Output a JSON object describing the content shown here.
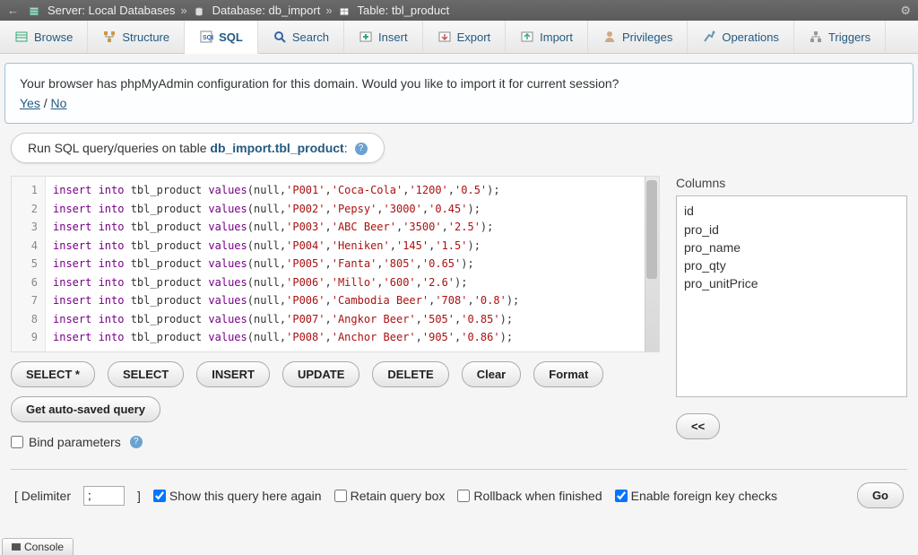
{
  "topbar": {
    "serverPrefix": "Server:",
    "serverName": "Local Databases",
    "dbPrefix": "Database:",
    "dbName": "db_import",
    "tablePrefix": "Table:",
    "tableName": "tbl_product"
  },
  "tabs": [
    {
      "label": "Browse"
    },
    {
      "label": "Structure"
    },
    {
      "label": "SQL"
    },
    {
      "label": "Search"
    },
    {
      "label": "Insert"
    },
    {
      "label": "Export"
    },
    {
      "label": "Import"
    },
    {
      "label": "Privileges"
    },
    {
      "label": "Operations"
    },
    {
      "label": "Triggers"
    }
  ],
  "notice": {
    "text": "Your browser has phpMyAdmin configuration for this domain. Would you like to import it for current session?",
    "yes": "Yes",
    "no": "No"
  },
  "section": {
    "prefix": "Run SQL query/queries on table ",
    "target": "db_import.tbl_product",
    "suffix": ":"
  },
  "editor": {
    "lines": [
      {
        "pre": "insert into",
        "mid": " tbl_product ",
        "kw": "values",
        "args": "(null,'P001','Coca-Cola','1200','0.5');"
      },
      {
        "pre": "insert into",
        "mid": " tbl_product ",
        "kw": "values",
        "args": "(null,'P002','Pepsy','3000','0.45');"
      },
      {
        "pre": "insert into",
        "mid": " tbl_product ",
        "kw": "values",
        "args": "(null,'P003','ABC Beer','3500','2.5');"
      },
      {
        "pre": "insert into",
        "mid": " tbl_product ",
        "kw": "values",
        "args": "(null,'P004','Heniken','145','1.5');"
      },
      {
        "pre": "insert into",
        "mid": " tbl_product ",
        "kw": "values",
        "args": "(null,'P005','Fanta','805','0.65');"
      },
      {
        "pre": "insert into",
        "mid": " tbl_product ",
        "kw": "values",
        "args": "(null,'P006','Millo','600','2.6');"
      },
      {
        "pre": "insert into",
        "mid": " tbl_product ",
        "kw": "values",
        "args": "(null,'P006','Cambodia Beer','708','0.8');"
      },
      {
        "pre": "insert into",
        "mid": " tbl_product ",
        "kw": "values",
        "args": "(null,'P007','Angkor Beer','505','0.85');"
      },
      {
        "pre": "insert into",
        "mid": " tbl_product ",
        "kw": "values",
        "args": "(null,'P008','Anchor Beer','905','0.86');"
      }
    ]
  },
  "buttons": {
    "selectStar": "SELECT *",
    "select": "SELECT",
    "insert": "INSERT",
    "update": "UPDATE",
    "delete": "DELETE",
    "clear": "Clear",
    "format": "Format",
    "autoSaved": "Get auto-saved query"
  },
  "bind": {
    "label": "Bind parameters"
  },
  "columnsPanel": {
    "title": "Columns",
    "items": [
      "id",
      "pro_id",
      "pro_name",
      "pro_qty",
      "pro_unitPrice"
    ],
    "insert": "<<"
  },
  "footer": {
    "delimLabelOpen": "[ Delimiter",
    "delimValue": ";",
    "delimLabelClose": "]",
    "showAgain": "Show this query here again",
    "retain": "Retain query box",
    "rollback": "Rollback when finished",
    "fk": "Enable foreign key checks",
    "go": "Go"
  },
  "console": {
    "label": "Console"
  }
}
